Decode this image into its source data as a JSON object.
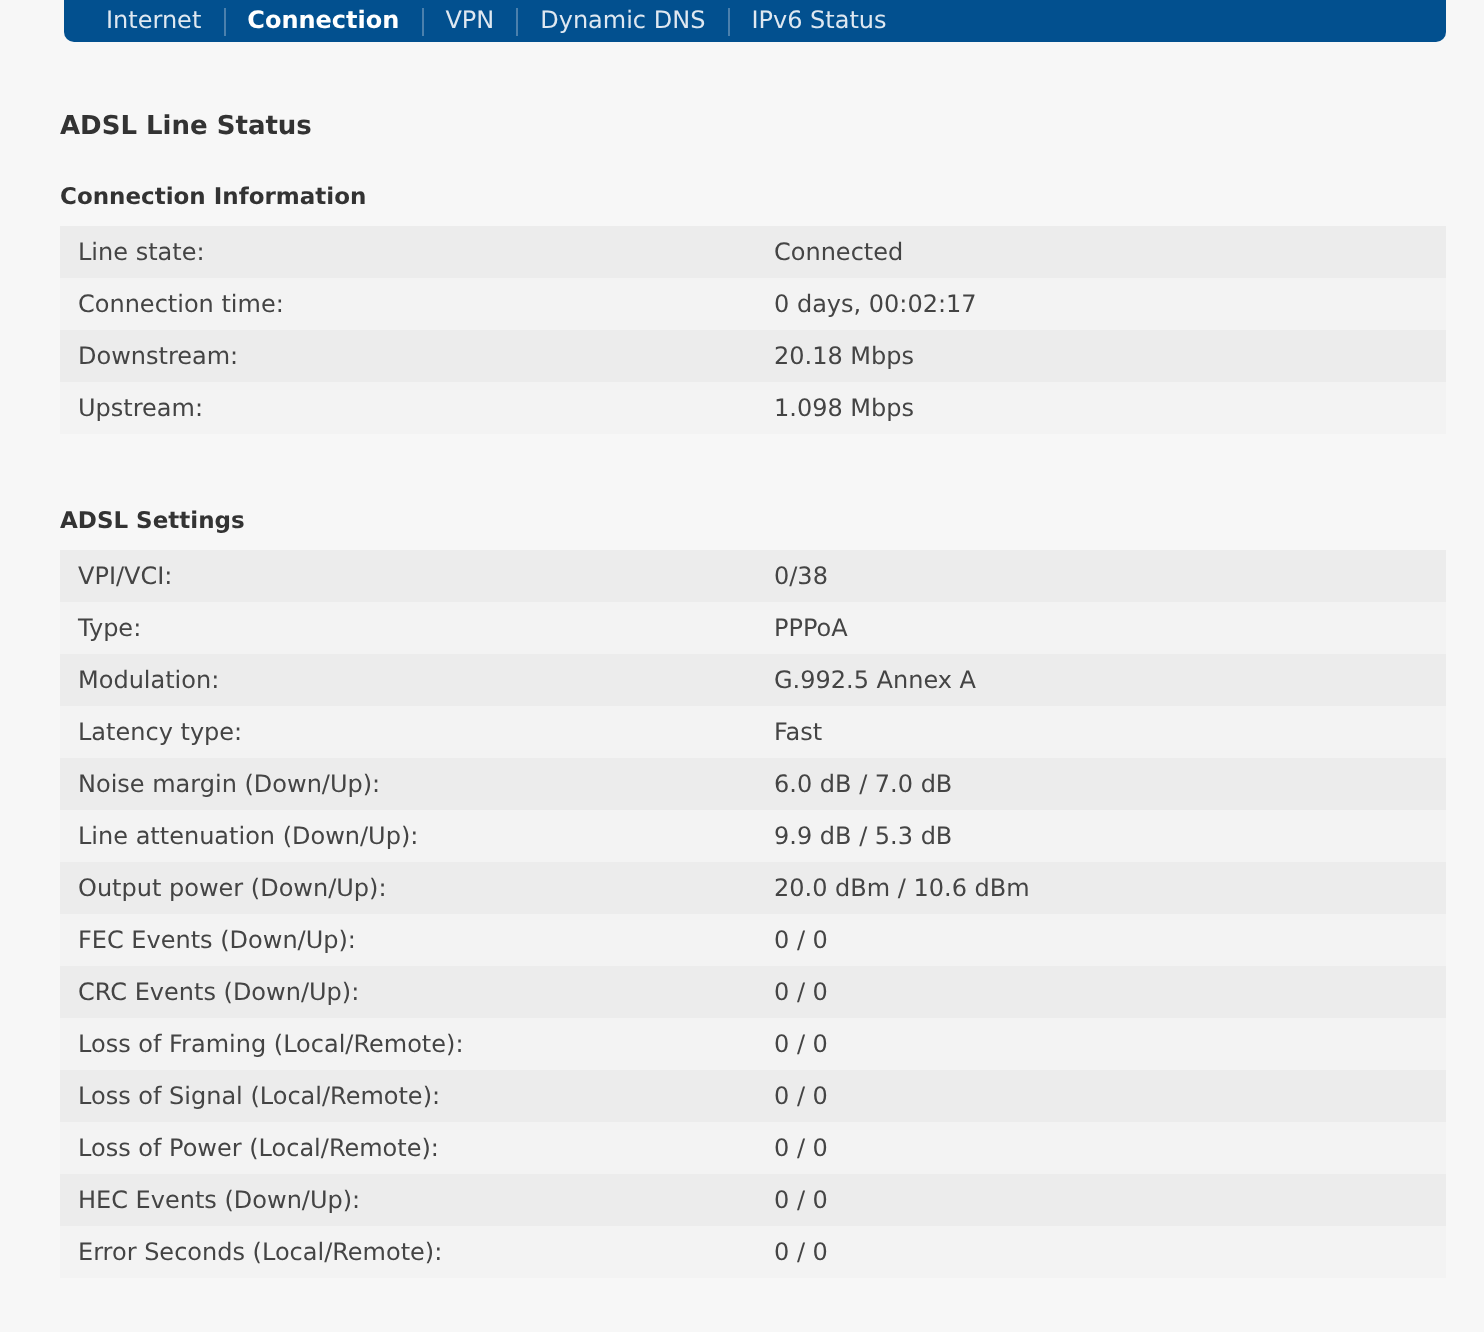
{
  "nav_tabs": [
    {
      "label": "Internet",
      "selected": false
    },
    {
      "label": "Connection",
      "selected": true
    },
    {
      "label": "VPN",
      "selected": false
    },
    {
      "label": "Dynamic DNS",
      "selected": false
    },
    {
      "label": "IPv6 Status",
      "selected": false
    }
  ],
  "page_title": "ADSL Line Status",
  "sections": [
    {
      "title": "Connection Information",
      "rows": [
        {
          "label": "Line state:",
          "value": "Connected"
        },
        {
          "label": "Connection time:",
          "value": "0 days, 00:02:17"
        },
        {
          "label": "Downstream:",
          "value": "20.18 Mbps"
        },
        {
          "label": "Upstream:",
          "value": "1.098 Mbps"
        }
      ]
    },
    {
      "title": "ADSL Settings",
      "rows": [
        {
          "label": "VPI/VCI:",
          "value": "0/38"
        },
        {
          "label": "Type:",
          "value": "PPPoA"
        },
        {
          "label": "Modulation:",
          "value": "G.992.5 Annex A"
        },
        {
          "label": "Latency type:",
          "value": "Fast"
        },
        {
          "label": "Noise margin (Down/Up):",
          "value": "6.0 dB / 7.0 dB"
        },
        {
          "label": "Line attenuation (Down/Up):",
          "value": "9.9 dB / 5.3 dB"
        },
        {
          "label": "Output power (Down/Up):",
          "value": "20.0 dBm / 10.6 dBm"
        },
        {
          "label": "FEC Events (Down/Up):",
          "value": "0 / 0"
        },
        {
          "label": "CRC Events (Down/Up):",
          "value": "0 / 0"
        },
        {
          "label": "Loss of Framing (Local/Remote):",
          "value": "0 / 0"
        },
        {
          "label": "Loss of Signal (Local/Remote):",
          "value": "0 / 0"
        },
        {
          "label": "Loss of Power (Local/Remote):",
          "value": "0 / 0"
        },
        {
          "label": "HEC Events (Down/Up):",
          "value": "0 / 0"
        },
        {
          "label": "Error Seconds (Local/Remote):",
          "value": "0 / 0"
        }
      ]
    }
  ]
}
